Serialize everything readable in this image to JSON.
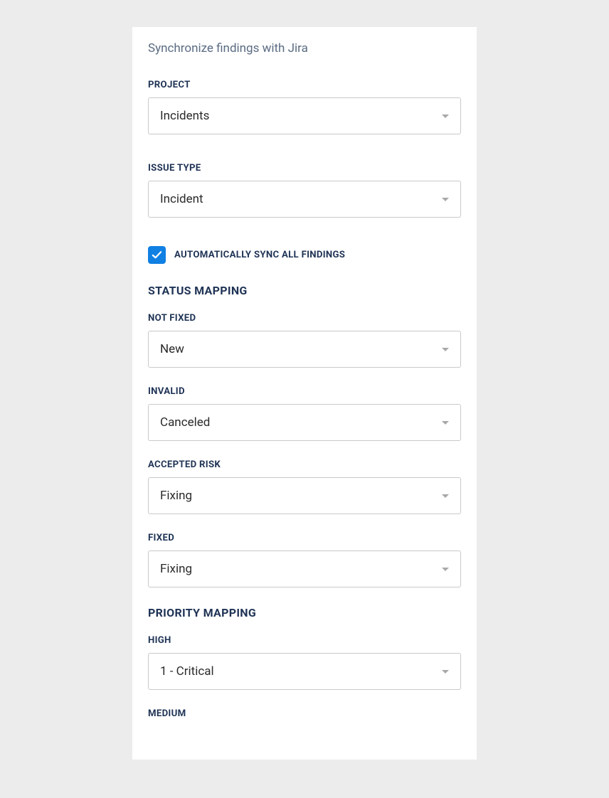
{
  "subtitle": "Synchronize findings with Jira",
  "project": {
    "label": "PROJECT",
    "value": "Incidents"
  },
  "issueType": {
    "label": "ISSUE TYPE",
    "value": "Incident"
  },
  "autoSync": {
    "label": "AUTOMATICALLY SYNC ALL FINDINGS",
    "checked": true
  },
  "statusMapping": {
    "heading": "STATUS MAPPING",
    "notFixed": {
      "label": "NOT FIXED",
      "value": "New"
    },
    "invalid": {
      "label": "INVALID",
      "value": "Canceled"
    },
    "acceptedRisk": {
      "label": "ACCEPTED RISK",
      "value": "Fixing"
    },
    "fixed": {
      "label": "FIXED",
      "value": "Fixing"
    }
  },
  "priorityMapping": {
    "heading": "PRIORITY MAPPING",
    "high": {
      "label": "HIGH",
      "value": "1 - Critical"
    },
    "medium": {
      "label": "MEDIUM"
    }
  }
}
